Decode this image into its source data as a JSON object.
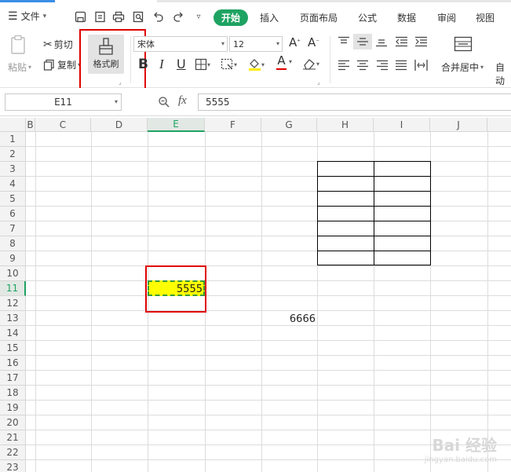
{
  "menubar": {
    "file_label": "文件",
    "tabs": [
      {
        "label": "开始",
        "active": true
      },
      {
        "label": "插入"
      },
      {
        "label": "页面布局"
      },
      {
        "label": "公式"
      },
      {
        "label": "数据"
      },
      {
        "label": "审阅"
      },
      {
        "label": "视图"
      }
    ]
  },
  "ribbon": {
    "paste_label": "粘贴",
    "cut_label": "剪切",
    "copy_label": "复制",
    "format_painter_label": "格式刷",
    "font_name": "宋体",
    "font_size": "12",
    "bold": "B",
    "italic": "I",
    "underline": "U",
    "font_color_letter": "A",
    "merge_center_label": "合并居中",
    "auto_label": "自动"
  },
  "formula_bar": {
    "cell_ref": "E11",
    "fx": "fx",
    "value": "5555"
  },
  "sheet": {
    "columns": [
      "B",
      "C",
      "D",
      "E",
      "F",
      "G",
      "H",
      "I",
      "J"
    ],
    "active_column": "E",
    "rows": [
      "1",
      "2",
      "3",
      "4",
      "5",
      "6",
      "7",
      "8",
      "9",
      "10",
      "11",
      "12",
      "13",
      "14",
      "15",
      "16",
      "17",
      "18",
      "19",
      "20",
      "21",
      "22",
      "23"
    ],
    "active_row": "11",
    "cells": [
      {
        "ref": "E11",
        "value": "5555"
      },
      {
        "ref": "G13",
        "value": "6666"
      }
    ]
  },
  "watermark": {
    "line1": "Bai 经验",
    "line2": "jingyan.baidu.com"
  },
  "colors": {
    "accent": "#1ea362",
    "highlight_box": "#e00000",
    "selected_fill": "#ffff00"
  }
}
